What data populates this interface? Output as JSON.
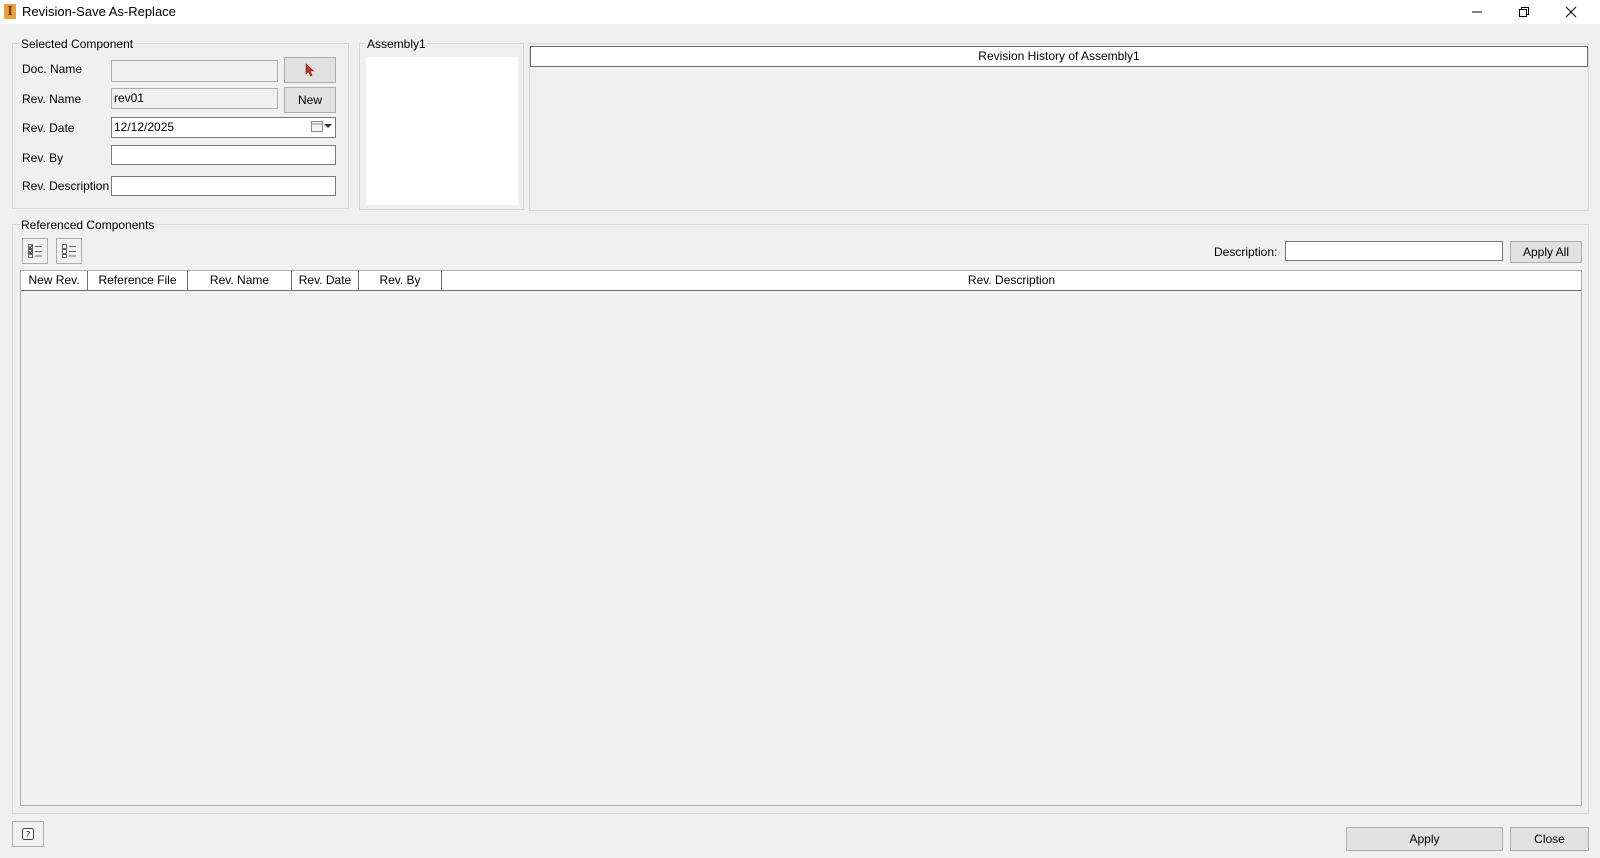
{
  "window": {
    "title": "Revision-Save As-Replace",
    "app_icon_glyph": "I",
    "minimize_icon": "minimize-icon",
    "restore_icon": "restore-icon",
    "close_icon": "close-icon"
  },
  "selected_component": {
    "group_label": "Selected Component",
    "doc_name_label": "Doc. Name",
    "doc_name_value": "",
    "rev_name_label": "Rev. Name",
    "rev_name_value": "rev01",
    "new_button": "New",
    "rev_date_label": "Rev. Date",
    "rev_date_value": "12/12/2025",
    "rev_by_label": "Rev. By",
    "rev_by_value": "",
    "rev_description_label": "Rev. Description",
    "rev_description_value": ""
  },
  "preview": {
    "group_label": "Assembly1"
  },
  "history": {
    "header": "Revision History of Assembly1"
  },
  "referenced": {
    "group_label": "Referenced Components",
    "description_label": "Description:",
    "description_value": "",
    "apply_all_button": "Apply All",
    "columns": [
      "New Rev.",
      "Reference File",
      "Rev. Name",
      "Rev. Date",
      "Rev. By",
      "Rev. Description"
    ],
    "rows": []
  },
  "footer": {
    "apply_button": "Apply",
    "close_button": "Close"
  },
  "colors": {
    "background": "#f0f0f0",
    "pick_arrow": "#c0392b",
    "app_icon": "#e8a23c"
  }
}
